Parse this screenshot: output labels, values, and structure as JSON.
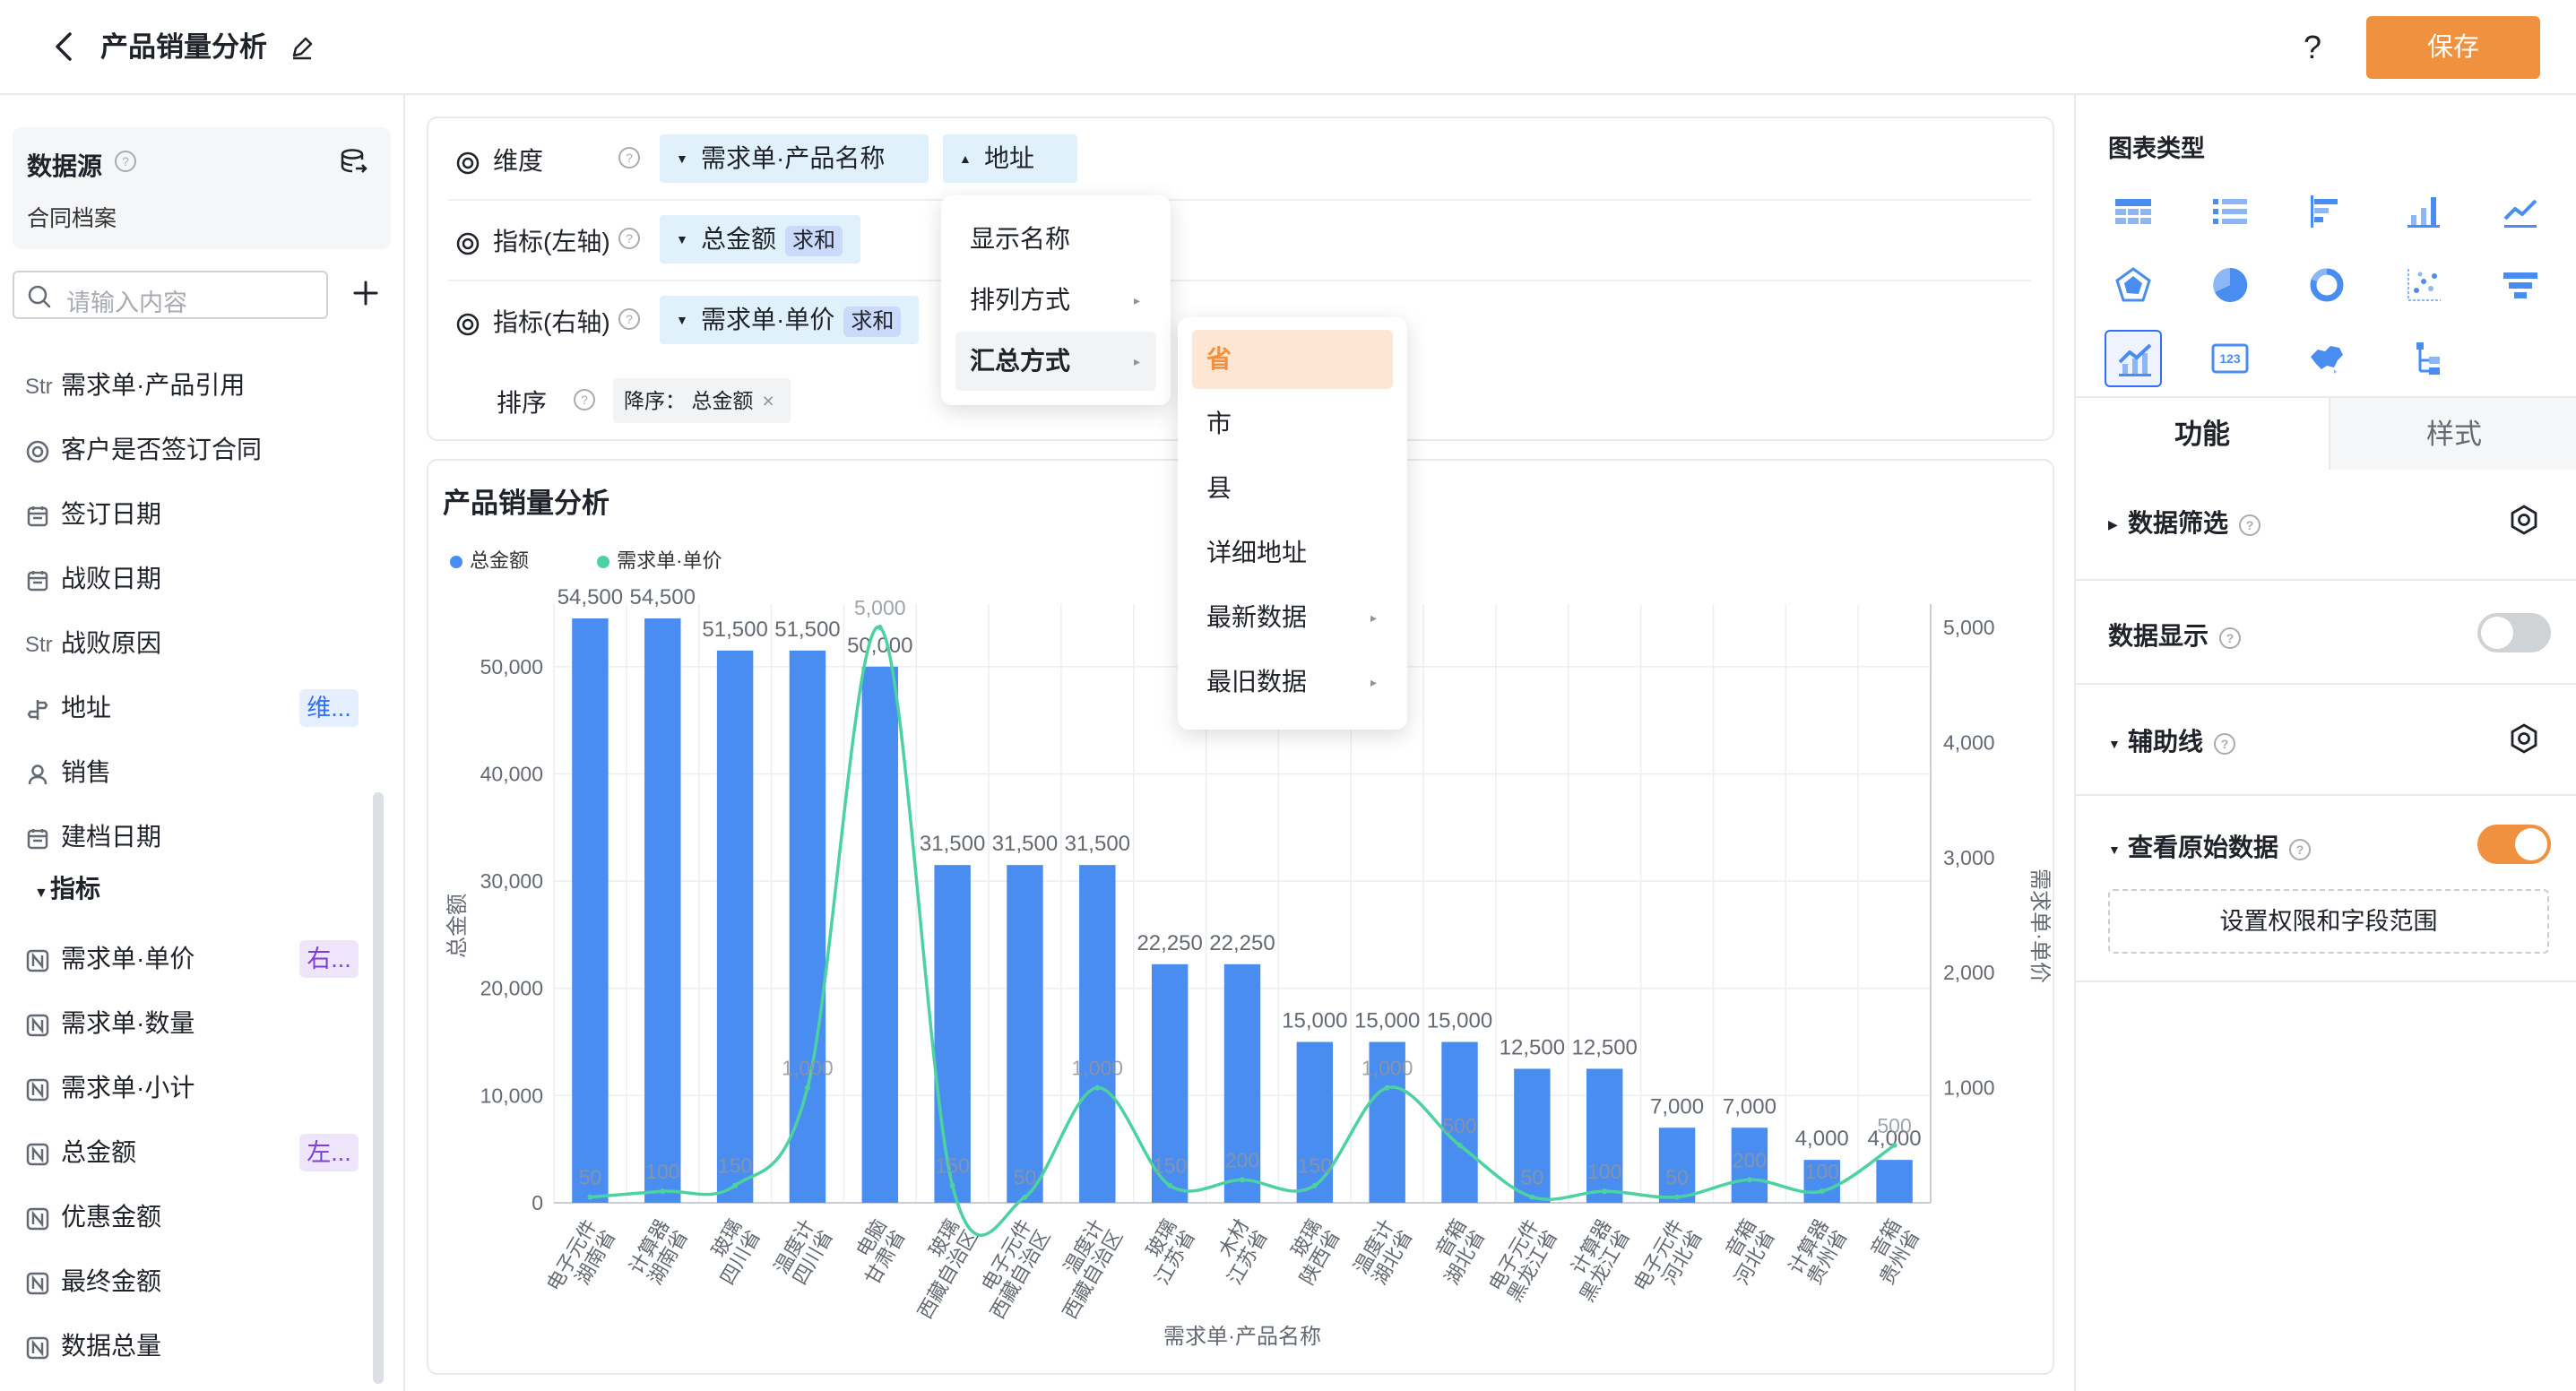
{
  "header": {
    "title": "产品销量分析",
    "help": "?",
    "save_label": "保存"
  },
  "datasource": {
    "title": "数据源",
    "name": "合同档案",
    "search_placeholder": "请输入内容"
  },
  "fields": [
    {
      "prefix": "Str",
      "icon": "",
      "label": "需求单·产品引用",
      "tag": ""
    },
    {
      "prefix": "",
      "icon": "radio",
      "label": "客户是否签订合同",
      "tag": ""
    },
    {
      "prefix": "",
      "icon": "calendar",
      "label": "签订日期",
      "tag": ""
    },
    {
      "prefix": "",
      "icon": "calendar",
      "label": "战败日期",
      "tag": ""
    },
    {
      "prefix": "Str",
      "icon": "",
      "label": "战败原因",
      "tag": ""
    },
    {
      "prefix": "",
      "icon": "location",
      "label": "地址",
      "tag": "维..."
    },
    {
      "prefix": "",
      "icon": "user",
      "label": "销售",
      "tag": ""
    },
    {
      "prefix": "",
      "icon": "calendar",
      "label": "建档日期",
      "tag": ""
    }
  ],
  "metrics_group": "指标",
  "metrics": [
    {
      "label": "需求单·单价",
      "tag": "右..."
    },
    {
      "label": "需求单·数量",
      "tag": ""
    },
    {
      "label": "需求单·小计",
      "tag": ""
    },
    {
      "label": "总金额",
      "tag": "左..."
    },
    {
      "label": "优惠金额",
      "tag": ""
    },
    {
      "label": "最终金额",
      "tag": ""
    },
    {
      "label": "数据总量",
      "tag": ""
    }
  ],
  "config": {
    "dimension_label": "维度",
    "dimension_pills": [
      "需求单·产品名称",
      "地址"
    ],
    "left_axis_label": "指标(左轴)",
    "left_axis_pill": "总金额",
    "left_axis_agg": "求和",
    "right_axis_label": "指标(右轴)",
    "right_axis_pill": "需求单·单价",
    "right_axis_agg": "求和",
    "sort_label": "排序",
    "sort_pill": "降序： 总金额",
    "sort_close": "×"
  },
  "menu1": {
    "items": [
      {
        "label": "显示名称",
        "arrow": ""
      },
      {
        "label": "排列方式",
        "arrow": "▸"
      },
      {
        "label": "汇总方式",
        "arrow": "▸"
      }
    ]
  },
  "menu2": {
    "items": [
      {
        "label": "省",
        "arrow": ""
      },
      {
        "label": "市",
        "arrow": ""
      },
      {
        "label": "县",
        "arrow": ""
      },
      {
        "label": "详细地址",
        "arrow": ""
      },
      {
        "label": "最新数据",
        "arrow": "▸"
      },
      {
        "label": "最旧数据",
        "arrow": "▸"
      }
    ]
  },
  "right_panel": {
    "chart_types_title": "图表类型",
    "tabs": [
      "功能",
      "样式"
    ],
    "sections": {
      "filter": "数据筛选",
      "display": "数据显示",
      "guide": "辅助线",
      "raw": "查看原始数据",
      "perm_button": "设置权限和字段范围"
    },
    "display_on": false,
    "raw_on": true
  },
  "colors": {
    "accent": "#f0913f",
    "bar": "#4a8df0",
    "line": "#4cd2a0",
    "tag_blue": "#3370ff"
  },
  "chart_data": {
    "type": "bar",
    "title": "产品销量分析",
    "xlabel": "需求单·产品名称",
    "ylabel": "总金额",
    "ylabel_right": "需求单·单价",
    "ylim": [
      0,
      55000
    ],
    "ylim_right": [
      0,
      5000
    ],
    "yticks": [
      "0",
      "10,000",
      "20,000",
      "30,000",
      "40,000",
      "50,000"
    ],
    "yticks_right": [
      "1,000",
      "2,000",
      "3,000",
      "4,000",
      "5,000"
    ],
    "categories": [
      "电子元件 湖南省",
      "计算器 湖南省",
      "玻璃 四川省",
      "温度计 四川省",
      "电脑 甘肃省",
      "玻璃 西藏自治区",
      "电子元件 西藏自治区",
      "温度计 西藏自治区",
      "玻璃 江苏省",
      "木材 江苏省",
      "玻璃 陕西省",
      "温度计 湖北省",
      "音箱 湖北省",
      "电子元件 黑龙江省",
      "计算器 黑龙江省",
      "电子元件 河北省",
      "音箱 河北省",
      "计算器 贵州省",
      "音箱 贵州省"
    ],
    "bar_labels": [
      "54,500",
      "54,500",
      "51,500",
      "51,500",
      "50,000",
      "31,500",
      "31,500",
      "31,500",
      "22,250",
      "22,250",
      "15,000",
      "15,000",
      "15,000",
      "12,500",
      "12,500",
      "7,000",
      "7,000",
      "4,000",
      "4,000"
    ],
    "line_labels": [
      "50",
      "100",
      "150",
      "1,000",
      "5,000",
      "150",
      "50",
      "1,000",
      "150",
      "200",
      "150",
      "1,000",
      "500",
      "50",
      "100",
      "50",
      "200",
      "100",
      "500"
    ],
    "series": [
      {
        "name": "总金额",
        "axis": "left",
        "values": [
          54500,
          54500,
          51500,
          51500,
          50000,
          31500,
          31500,
          31500,
          22250,
          22250,
          15000,
          15000,
          15000,
          12500,
          12500,
          7000,
          7000,
          4000,
          4000
        ]
      },
      {
        "name": "需求单·单价",
        "axis": "right",
        "values": [
          50,
          100,
          150,
          1000,
          5000,
          150,
          50,
          1000,
          150,
          200,
          150,
          1000,
          500,
          50,
          100,
          50,
          200,
          100,
          500
        ]
      }
    ],
    "grid": true,
    "legend": "top-left"
  }
}
